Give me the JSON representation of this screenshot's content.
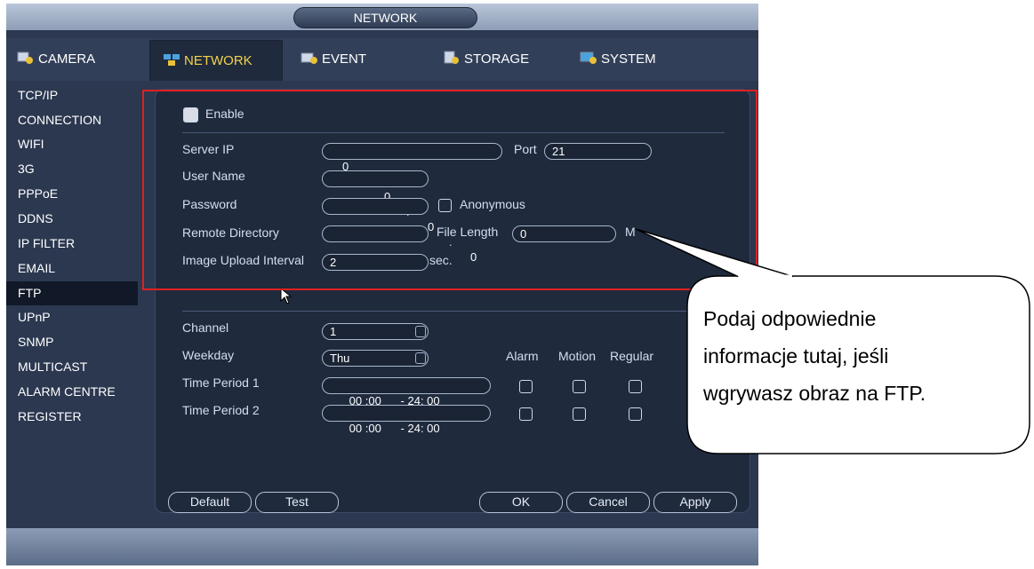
{
  "window": {
    "title": "NETWORK"
  },
  "tabs": [
    {
      "label": "CAMERA",
      "icon": "camera-settings-icon"
    },
    {
      "label": "NETWORK",
      "icon": "network-icon"
    },
    {
      "label": "EVENT",
      "icon": "event-icon"
    },
    {
      "label": "STORAGE",
      "icon": "storage-icon"
    },
    {
      "label": "SYSTEM",
      "icon": "system-icon"
    }
  ],
  "sidebar": {
    "items": [
      "TCP/IP",
      "CONNECTION",
      "WIFI",
      "3G",
      "PPPoE",
      "DDNS",
      "IP FILTER",
      "EMAIL",
      "FTP",
      "UPnP",
      "SNMP",
      "MULTICAST",
      "ALARM CENTRE",
      "REGISTER"
    ],
    "selected": "FTP"
  },
  "ftp": {
    "enable_label": "Enable",
    "server_ip_label": "Server IP",
    "server_ip": [
      "0",
      "0",
      "0",
      "0"
    ],
    "port_label": "Port",
    "port_value": "21",
    "user_name_label": "User Name",
    "user_name_value": "",
    "password_label": "Password",
    "password_value": "",
    "anonymous_label": "Anonymous",
    "remote_dir_label": "Remote Directory",
    "remote_dir_value": "",
    "file_length_label": "File Length",
    "file_length_value": "0",
    "file_length_unit": "M",
    "upload_interval_label": "Image Upload Interval",
    "upload_interval_value": "2",
    "upload_interval_unit": "sec."
  },
  "schedule": {
    "channel_label": "Channel",
    "channel_value": "1",
    "weekday_label": "Weekday",
    "weekday_value": "Thu",
    "col_alarm": "Alarm",
    "col_motion": "Motion",
    "col_regular": "Regular",
    "periods": [
      {
        "label": "Time Period 1",
        "start_h": "00",
        "start_m": "00",
        "end_h": "24",
        "end_m": "00"
      },
      {
        "label": "Time Period 2",
        "start_h": "00",
        "start_m": "00",
        "end_h": "24",
        "end_m": "00"
      }
    ]
  },
  "buttons": {
    "default": "Default",
    "test": "Test",
    "ok": "OK",
    "cancel": "Cancel",
    "apply": "Apply"
  },
  "callout": {
    "lines": [
      "Podaj odpowiednie",
      "informacje tutaj, jeśli",
      "wgrywasz obraz na FTP."
    ]
  },
  "colors": {
    "window_bg": "#2b3850",
    "highlight_border": "#e02020",
    "selected_item_bg": "#111827"
  }
}
